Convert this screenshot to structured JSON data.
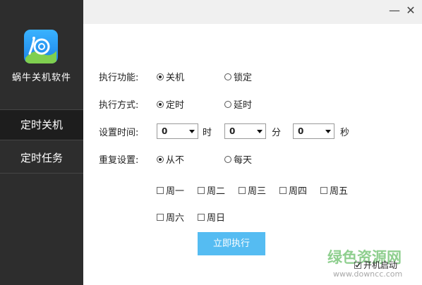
{
  "app": {
    "title": "蜗牛关机软件"
  },
  "sidebar": {
    "items": [
      {
        "label": "定时关机"
      },
      {
        "label": "定时任务"
      }
    ]
  },
  "window": {
    "minimize": "—",
    "close": "✕"
  },
  "form": {
    "function": {
      "label": "执行功能:",
      "options": [
        "关机",
        "锁定"
      ],
      "selected": "关机"
    },
    "mode": {
      "label": "执行方式:",
      "options": [
        "定时",
        "延时"
      ],
      "selected": "定时"
    },
    "time": {
      "label": "设置时间:",
      "hour": "0",
      "hour_unit": "时",
      "minute": "0",
      "minute_unit": "分",
      "second": "0",
      "second_unit": "秒"
    },
    "repeat": {
      "label": "重复设置:",
      "options": [
        "从不",
        "每天"
      ],
      "selected": "从不"
    },
    "weekdays": [
      "周一",
      "周二",
      "周三",
      "周四",
      "周五",
      "周六",
      "周日"
    ]
  },
  "run_button": "立即执行",
  "autostart": {
    "label": "开机启动",
    "checked": true
  },
  "watermark": {
    "text": "绿色资源网",
    "url": "www.downcc.com"
  }
}
